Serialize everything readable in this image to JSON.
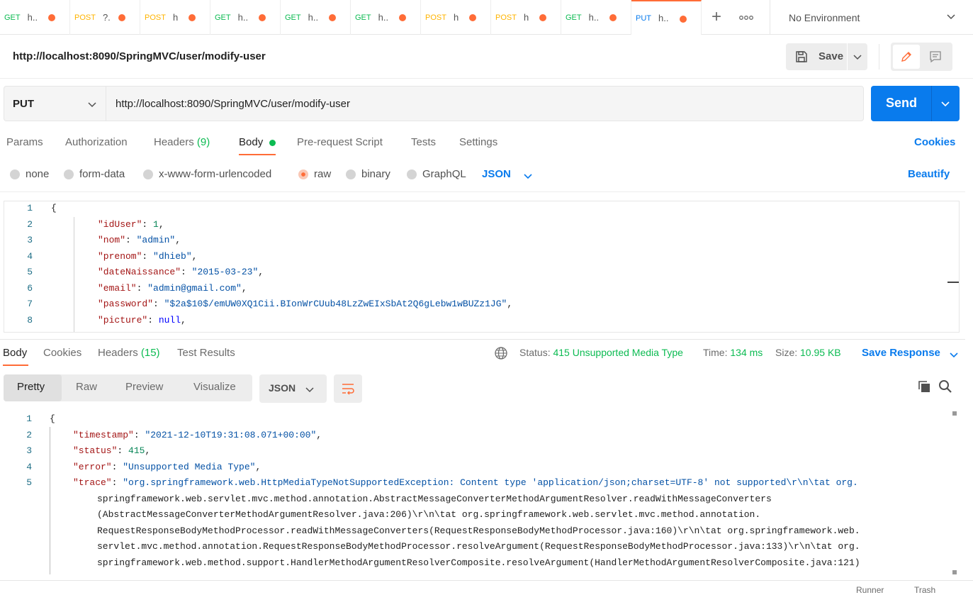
{
  "tabs": [
    {
      "method": "GET",
      "title": "h..",
      "cls": "m-get"
    },
    {
      "method": "POST",
      "title": "?.",
      "cls": "m-post"
    },
    {
      "method": "POST",
      "title": "h",
      "cls": "m-post"
    },
    {
      "method": "GET",
      "title": "h..",
      "cls": "m-get"
    },
    {
      "method": "GET",
      "title": "h..",
      "cls": "m-get"
    },
    {
      "method": "GET",
      "title": "h..",
      "cls": "m-get"
    },
    {
      "method": "POST",
      "title": "h",
      "cls": "m-post"
    },
    {
      "method": "POST",
      "title": "h",
      "cls": "m-post"
    },
    {
      "method": "GET",
      "title": "h..",
      "cls": "m-get"
    },
    {
      "method": "PUT",
      "title": "h..",
      "cls": "m-put",
      "active": true
    }
  ],
  "environment": {
    "label": "No Environment"
  },
  "request": {
    "title": "http://localhost:8090/SpringMVC/user/modify-user",
    "method": "PUT",
    "url": "http://localhost:8090/SpringMVC/user/modify-user",
    "save_label": "Save",
    "send_label": "Send"
  },
  "request_tabs": {
    "params": "Params",
    "authorization": "Authorization",
    "headers": "Headers",
    "headers_count": "(9)",
    "body": "Body",
    "prerequest": "Pre-request Script",
    "tests": "Tests",
    "settings": "Settings",
    "cookies": "Cookies"
  },
  "body_types": {
    "none": "none",
    "form_data": "form-data",
    "urlencoded": "x-www-form-urlencoded",
    "raw": "raw",
    "binary": "binary",
    "graphql": "GraphQL",
    "format": "JSON",
    "beautify": "Beautify"
  },
  "request_body": [
    {
      "n": "1",
      "key": "",
      "val": "",
      "punct": "{"
    },
    {
      "n": "2",
      "key": "\"idUser\"",
      "val": "1",
      "vt": "n",
      "punct": ","
    },
    {
      "n": "3",
      "key": "\"nom\"",
      "val": "\"admin\"",
      "vt": "s",
      "punct": ","
    },
    {
      "n": "4",
      "key": "\"prenom\"",
      "val": "\"dhieb\"",
      "vt": "s",
      "punct": ","
    },
    {
      "n": "5",
      "key": "\"dateNaissance\"",
      "val": "\"2015-03-23\"",
      "vt": "s",
      "punct": ","
    },
    {
      "n": "6",
      "key": "\"email\"",
      "val": "\"admin@gmail.com\"",
      "vt": "s",
      "punct": ","
    },
    {
      "n": "7",
      "key": "\"password\"",
      "val": "\"$2a$10$/emUW0XQ1Cii.BIonWrCUub48LzZwEIxSbAt2Q6gLebw1wBUZz1JG\"",
      "vt": "s",
      "punct": ","
    },
    {
      "n": "8",
      "key": "\"picture\"",
      "val": "null",
      "vt": "kw",
      "punct": ","
    }
  ],
  "response_tabs": {
    "body": "Body",
    "cookies": "Cookies",
    "headers": "Headers",
    "headers_count": "(15)",
    "test_results": "Test Results"
  },
  "response_status": {
    "status_label": "Status:",
    "status_value": "415 Unsupported Media Type",
    "time_label": "Time:",
    "time_value": "134 ms",
    "size_label": "Size:",
    "size_value": "10.95 KB",
    "save_response": "Save Response"
  },
  "response_views": {
    "pretty": "Pretty",
    "raw": "Raw",
    "preview": "Preview",
    "visualize": "Visualize",
    "format": "JSON"
  },
  "response_body": [
    {
      "n": "1",
      "text": "{"
    },
    {
      "n": "2",
      "key": "\"timestamp\"",
      "val": "\"2021-12-10T19:31:08.071+00:00\"",
      "vt": "s",
      "punct": ","
    },
    {
      "n": "3",
      "key": "\"status\"",
      "val": "415",
      "vt": "n",
      "punct": ","
    },
    {
      "n": "4",
      "key": "\"error\"",
      "val": "\"Unsupported Media Type\"",
      "vt": "s",
      "punct": ","
    },
    {
      "n": "5",
      "key": "\"trace\"",
      "val": "\"org.springframework.web.HttpMediaTypeNotSupportedException: Content type 'application/json;charset=UTF-8' not supported\\r\\n\\tat org.",
      "vt": "s"
    }
  ],
  "trace_continuation": [
    "springframework.web.servlet.mvc.method.annotation.AbstractMessageConverterMethodArgumentResolver.readWithMessageConverters",
    "(AbstractMessageConverterMethodArgumentResolver.java:206)\\r\\n\\tat org.springframework.web.servlet.mvc.method.annotation.",
    "RequestResponseBodyMethodProcessor.readWithMessageConverters(RequestResponseBodyMethodProcessor.java:160)\\r\\n\\tat org.springframework.web.",
    "servlet.mvc.method.annotation.RequestResponseBodyMethodProcessor.resolveArgument(RequestResponseBodyMethodProcessor.java:133)\\r\\n\\tat org.",
    "springframework.web.method.support.HandlerMethodArgumentResolverComposite.resolveArgument(HandlerMethodArgumentResolverComposite.java:121)"
  ],
  "footer": {
    "runner": "Runner",
    "trash": "Trash"
  },
  "colors": {
    "accent": "#ff6c37",
    "primary": "#097bed",
    "success": "#0cbb52"
  }
}
